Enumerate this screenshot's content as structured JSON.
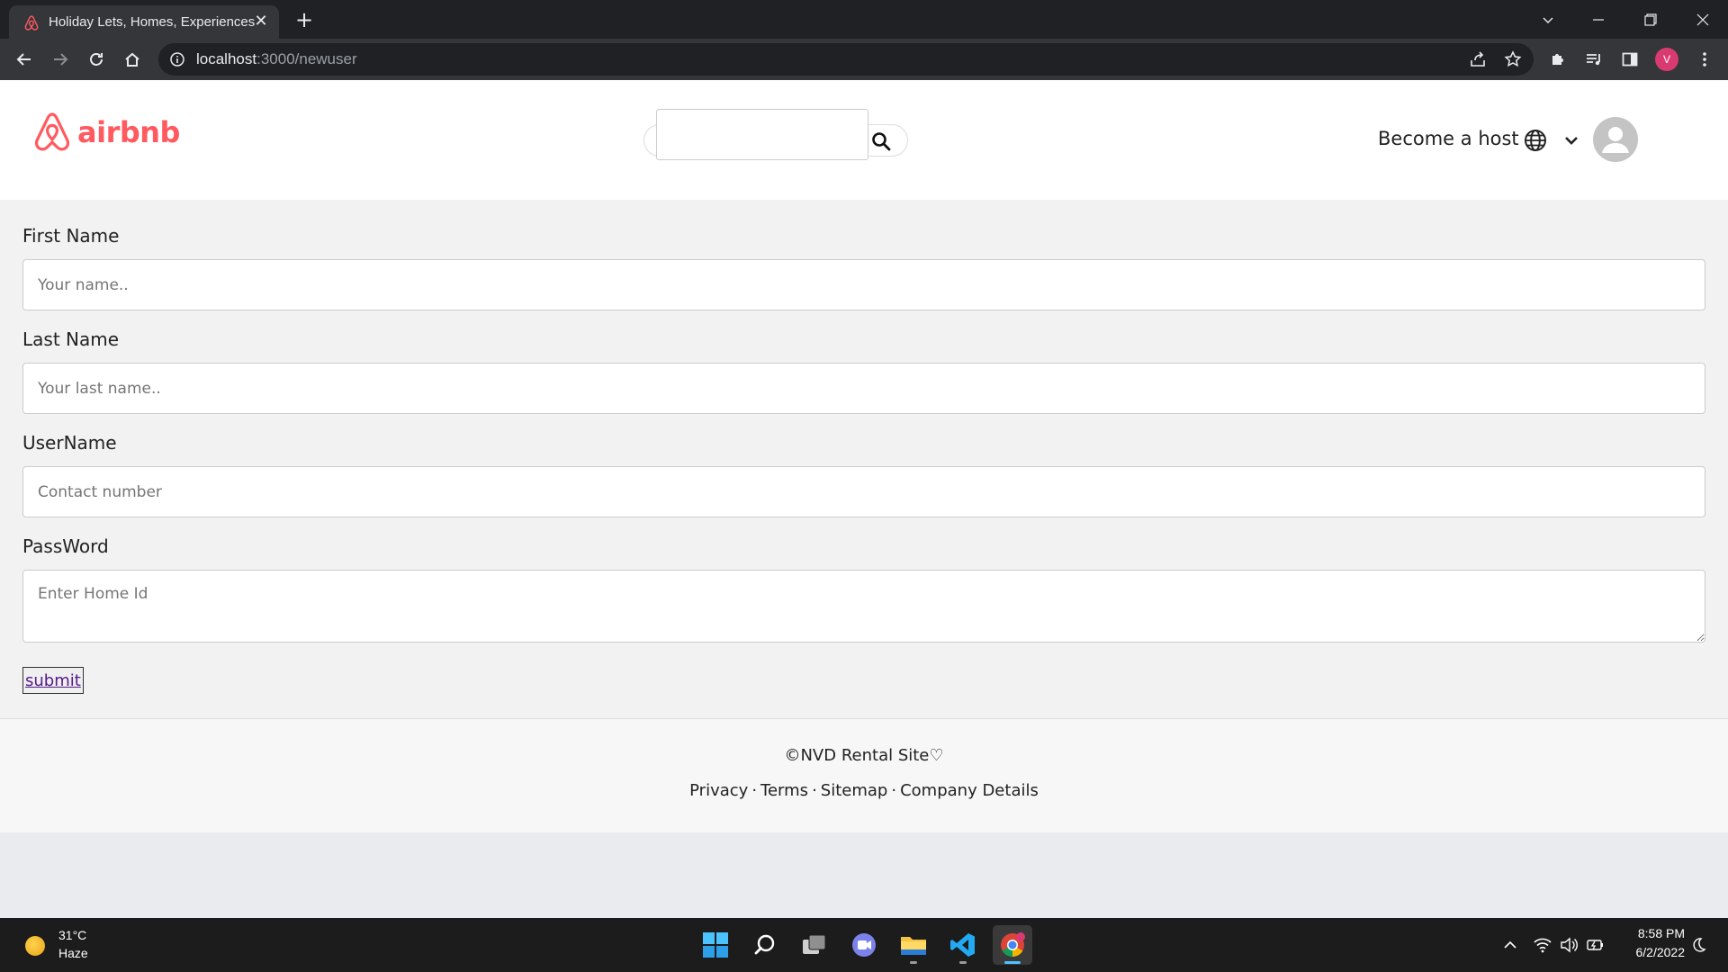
{
  "browser": {
    "tab_title": "Holiday Lets, Homes, Experiences & Places - Airbnb",
    "new_tab_symbol": "+",
    "close_symbol": "✕",
    "url_host": "localhost",
    "url_path": ":3000/newuser",
    "profile_initial": "V",
    "accent_color": "#d93b70"
  },
  "header": {
    "logo_text": "airbnb",
    "brand_color": "#ff5a5f",
    "search_value": "",
    "host_link": "Become a host"
  },
  "form": {
    "fields": [
      {
        "label": "First Name",
        "placeholder": "Your name.."
      },
      {
        "label": "Last Name",
        "placeholder": "Your last name.."
      },
      {
        "label": "UserName",
        "placeholder": "Contact number"
      },
      {
        "label": "PassWord",
        "placeholder": "Enter Home Id"
      }
    ],
    "submit_label": "submit"
  },
  "footer": {
    "copyright": "©NVD Rental Site♡",
    "links": [
      "Privacy",
      "Terms",
      "Sitemap",
      "Company Details"
    ],
    "separator": "·"
  },
  "taskbar": {
    "weather_temp": "31°C",
    "weather_condition": "Haze",
    "time": "8:58 PM",
    "date": "6/2/2022",
    "apps": [
      "start-icon",
      "search-icon",
      "task-view-icon",
      "teams-chat-icon",
      "file-explorer-icon",
      "vscode-icon",
      "chrome-icon"
    ]
  }
}
